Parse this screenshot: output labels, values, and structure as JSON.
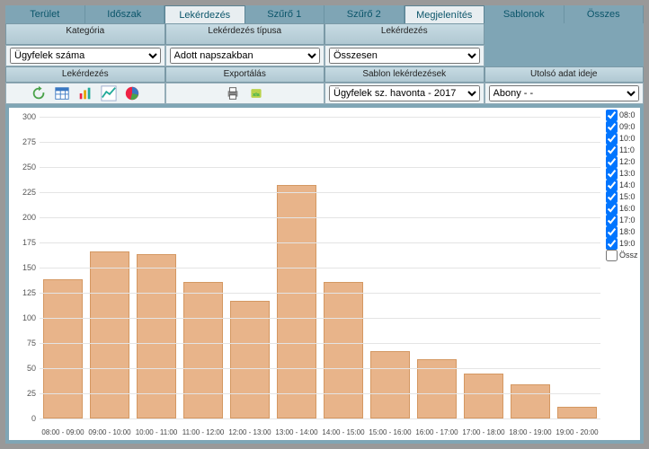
{
  "tabs": [
    "Terület",
    "Időszak",
    "Lekérdezés",
    "Szűrő 1",
    "Szűrő 2",
    "Megjelenítés",
    "Sablonok",
    "Összes"
  ],
  "tabs_active": [
    2,
    5
  ],
  "row1": {
    "headers": [
      "Kategória",
      "Lekérdezés típusa",
      "Lekérdezés",
      ""
    ],
    "category": {
      "selected": "Ügyfelek száma"
    },
    "querytype": {
      "selected": "Adott napszakban"
    },
    "query": {
      "selected": "Összesen"
    }
  },
  "row2": {
    "headers": [
      "Lekérdezés",
      "Exportálás",
      "Sablon lekérdezések",
      "Utolsó adat ideje"
    ],
    "template": {
      "selected": "Ügyfelek sz. havonta - 2017"
    },
    "lastdata": {
      "selected": "Abony - -"
    }
  },
  "chart_data": {
    "type": "bar",
    "categories": [
      "08:00 - 09:00",
      "09:00 - 10:00",
      "10:00 - 11:00",
      "11:00 - 12:00",
      "12:00 - 13:00",
      "13:00 - 14:00",
      "14:00 - 15:00",
      "15:00 - 16:00",
      "16:00 - 17:00",
      "17:00 - 18:00",
      "18:00 - 19:00",
      "19:00 - 20:00"
    ],
    "values": [
      138,
      166,
      163,
      136,
      117,
      232,
      136,
      67,
      59,
      45,
      34,
      12
    ],
    "title": "",
    "xlabel": "",
    "ylabel": "",
    "ylim": [
      0,
      300
    ],
    "yticks": [
      0,
      25,
      50,
      75,
      100,
      125,
      150,
      175,
      200,
      225,
      250,
      275,
      300
    ]
  },
  "legend": {
    "items": [
      {
        "label": "08:0",
        "checked": true
      },
      {
        "label": "09:0",
        "checked": true
      },
      {
        "label": "10:0",
        "checked": true
      },
      {
        "label": "11:0",
        "checked": true
      },
      {
        "label": "12:0",
        "checked": true
      },
      {
        "label": "13:0",
        "checked": true
      },
      {
        "label": "14:0",
        "checked": true
      },
      {
        "label": "15:0",
        "checked": true
      },
      {
        "label": "16:0",
        "checked": true
      },
      {
        "label": "17:0",
        "checked": true
      },
      {
        "label": "18:0",
        "checked": true
      },
      {
        "label": "19:0",
        "checked": true
      },
      {
        "label": "Össz",
        "checked": false
      }
    ]
  }
}
